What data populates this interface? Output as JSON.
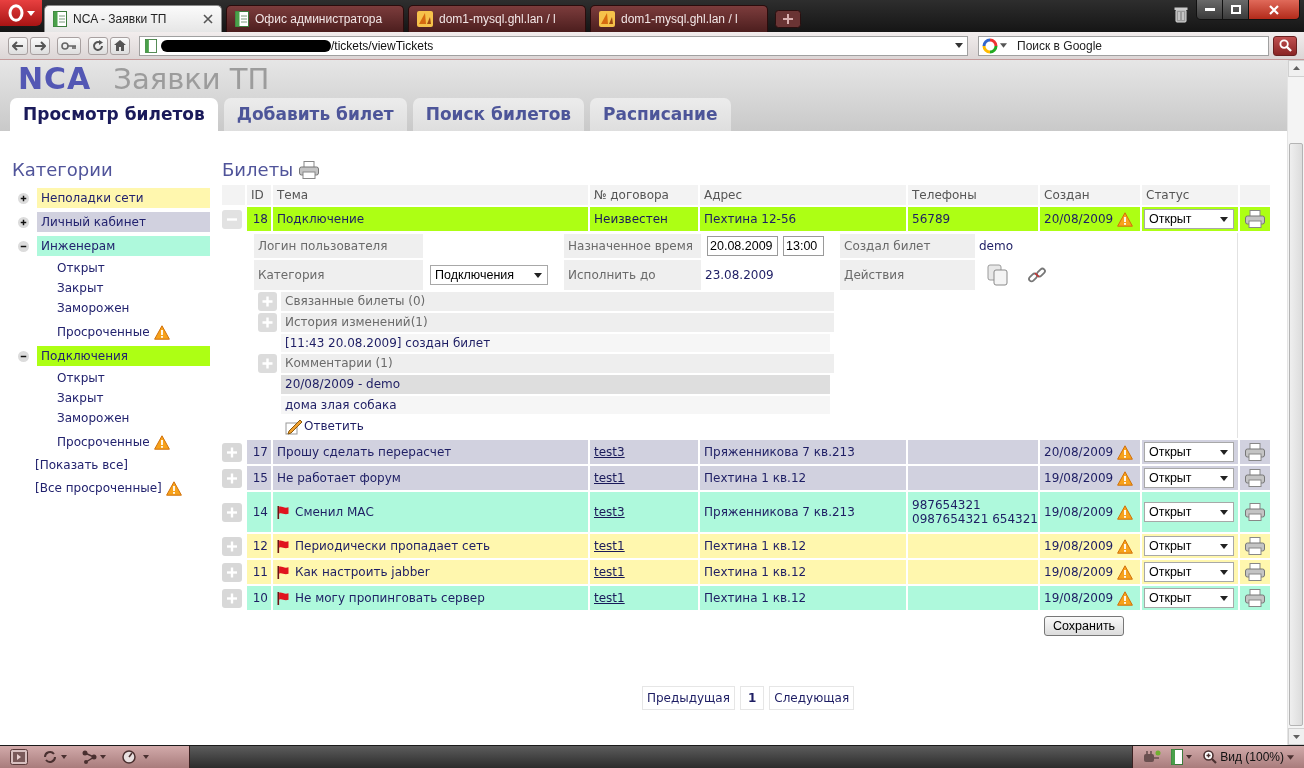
{
  "browser": {
    "tabs": [
      {
        "title": "NCA - Заявки ТП",
        "kind": "page",
        "selected": true
      },
      {
        "title": "Офис администратора",
        "kind": "page",
        "selected": false
      },
      {
        "title": "dom1-mysql.ghl.lan / l",
        "kind": "pma",
        "selected": false
      },
      {
        "title": "dom1-mysql.ghl.lan / l",
        "kind": "pma",
        "selected": false
      }
    ],
    "address": "/tickets/viewTickets",
    "search_placeholder": "Поиск в Google"
  },
  "header": {
    "logo": "NCA",
    "subtitle": "Заявки ТП"
  },
  "nav_tabs": [
    {
      "label": "Просмотр билетов",
      "selected": true
    },
    {
      "label": "Добавить билет",
      "selected": false
    },
    {
      "label": "Поиск билетов",
      "selected": false
    },
    {
      "label": "Расписание",
      "selected": false
    }
  ],
  "sidebar": {
    "title": "Категории",
    "categories": [
      {
        "label": "Неполадки сети",
        "color": "#fff7ae",
        "expanded": false
      },
      {
        "label": "Личный кабинет",
        "color": "#d1d1df",
        "expanded": false
      },
      {
        "label": "Инженерам",
        "color": "#aef9dc",
        "expanded": true,
        "children": [
          {
            "label": "Открыт",
            "overdue": false
          },
          {
            "label": "Закрыт",
            "overdue": false
          },
          {
            "label": "Заморожен",
            "overdue": false
          },
          {
            "label": "Просроченные",
            "overdue": true
          }
        ]
      },
      {
        "label": "Подключения",
        "color": "#adff14",
        "expanded": true,
        "children": [
          {
            "label": "Открыт",
            "overdue": false
          },
          {
            "label": "Закрыт",
            "overdue": false
          },
          {
            "label": "Заморожен",
            "overdue": false
          },
          {
            "label": "Просроченные",
            "overdue": true
          }
        ]
      }
    ],
    "links": [
      {
        "label": "[Показать все]",
        "overdue": false
      },
      {
        "label": "[Все просроченные]",
        "overdue": true
      }
    ]
  },
  "tickets": {
    "title": "Билеты",
    "columns": [
      "ID",
      "Тема",
      "№ договора",
      "Адрес",
      "Телефоны",
      "Создан",
      "Статус"
    ],
    "rows": [
      {
        "id": "18",
        "subject": "Подключение",
        "flagged": false,
        "contract": "Неизвестен",
        "contract_link": false,
        "address": "Пехтина 12-56",
        "phones": [
          "56789"
        ],
        "created": "20/08/2009",
        "overdue": true,
        "status": "Открыт",
        "color": "#adff14",
        "expanded": true,
        "details": {
          "login_label": "Логин пользователя",
          "assigned_label": "Назначенное время",
          "assigned_date": "20.08.2009",
          "assigned_time": "13:00",
          "creator_label": "Создал билет",
          "creator": "demo",
          "category_label": "Категория",
          "category": "Подключения",
          "due_label": "Исполнить до",
          "due": "23.08.2009",
          "actions_label": "Действия",
          "sections": [
            {
              "title": "Связанные билеты (0)"
            },
            {
              "title": "История изменений(1)",
              "entries": [
                "[11:43 20.08.2009] создан билет"
              ]
            },
            {
              "title": "Комментарии (1)",
              "comments": [
                {
                  "header": "20/08/2009 - demo",
                  "body": "дома злая собака"
                }
              ],
              "reply": "Ответить"
            }
          ]
        }
      },
      {
        "id": "17",
        "subject": "Прошу сделать перерасчет",
        "flagged": false,
        "contract": "test3",
        "contract_link": true,
        "address": "Пряженникова 7 кв.213",
        "created": "20/08/2009",
        "overdue": true,
        "status": "Открыт",
        "color": "#d1d1df",
        "expanded": false
      },
      {
        "id": "15",
        "subject": "Не работает форум",
        "flagged": false,
        "contract": "test1",
        "contract_link": true,
        "address": "Пехтина 1 кв.12",
        "created": "19/08/2009",
        "overdue": true,
        "status": "Открыт",
        "color": "#d1d1df",
        "expanded": false
      },
      {
        "id": "14",
        "subject": "Сменил МАС",
        "flagged": true,
        "contract": "test3",
        "contract_link": true,
        "address": "Пряженникова 7 кв.213",
        "phones": [
          "987654321",
          "0987654321 654321"
        ],
        "created": "19/08/2009",
        "overdue": true,
        "status": "Открыт",
        "color": "#aef9dc",
        "expanded": false
      },
      {
        "id": "12",
        "subject": "Периодически пропадает сеть",
        "flagged": true,
        "contract": "test1",
        "contract_link": true,
        "address": "Пехтина 1 кв.12",
        "created": "19/08/2009",
        "overdue": true,
        "status": "Открыт",
        "color": "#fff7ae",
        "expanded": false
      },
      {
        "id": "11",
        "subject": "Как настроить jabber",
        "flagged": true,
        "contract": "test1",
        "contract_link": true,
        "address": "Пехтина 1 кв.12",
        "created": "19/08/2009",
        "overdue": true,
        "status": "Открыт",
        "color": "#fff7ae",
        "expanded": false
      },
      {
        "id": "10",
        "subject": "Не могу пропинговать сервер",
        "flagged": true,
        "contract": "test1",
        "contract_link": true,
        "address": "Пехтина 1 кв.12",
        "created": "19/08/2009",
        "overdue": true,
        "status": "Открыт",
        "color": "#aef9dc",
        "expanded": false
      }
    ],
    "save_button": "Сохранить"
  },
  "pagination": {
    "previous": "Предыдущая",
    "pages": [
      {
        "label": "1",
        "selected": true
      }
    ],
    "next": "Следующая"
  },
  "status_bar": {
    "zoom": "Вид (100%)"
  }
}
